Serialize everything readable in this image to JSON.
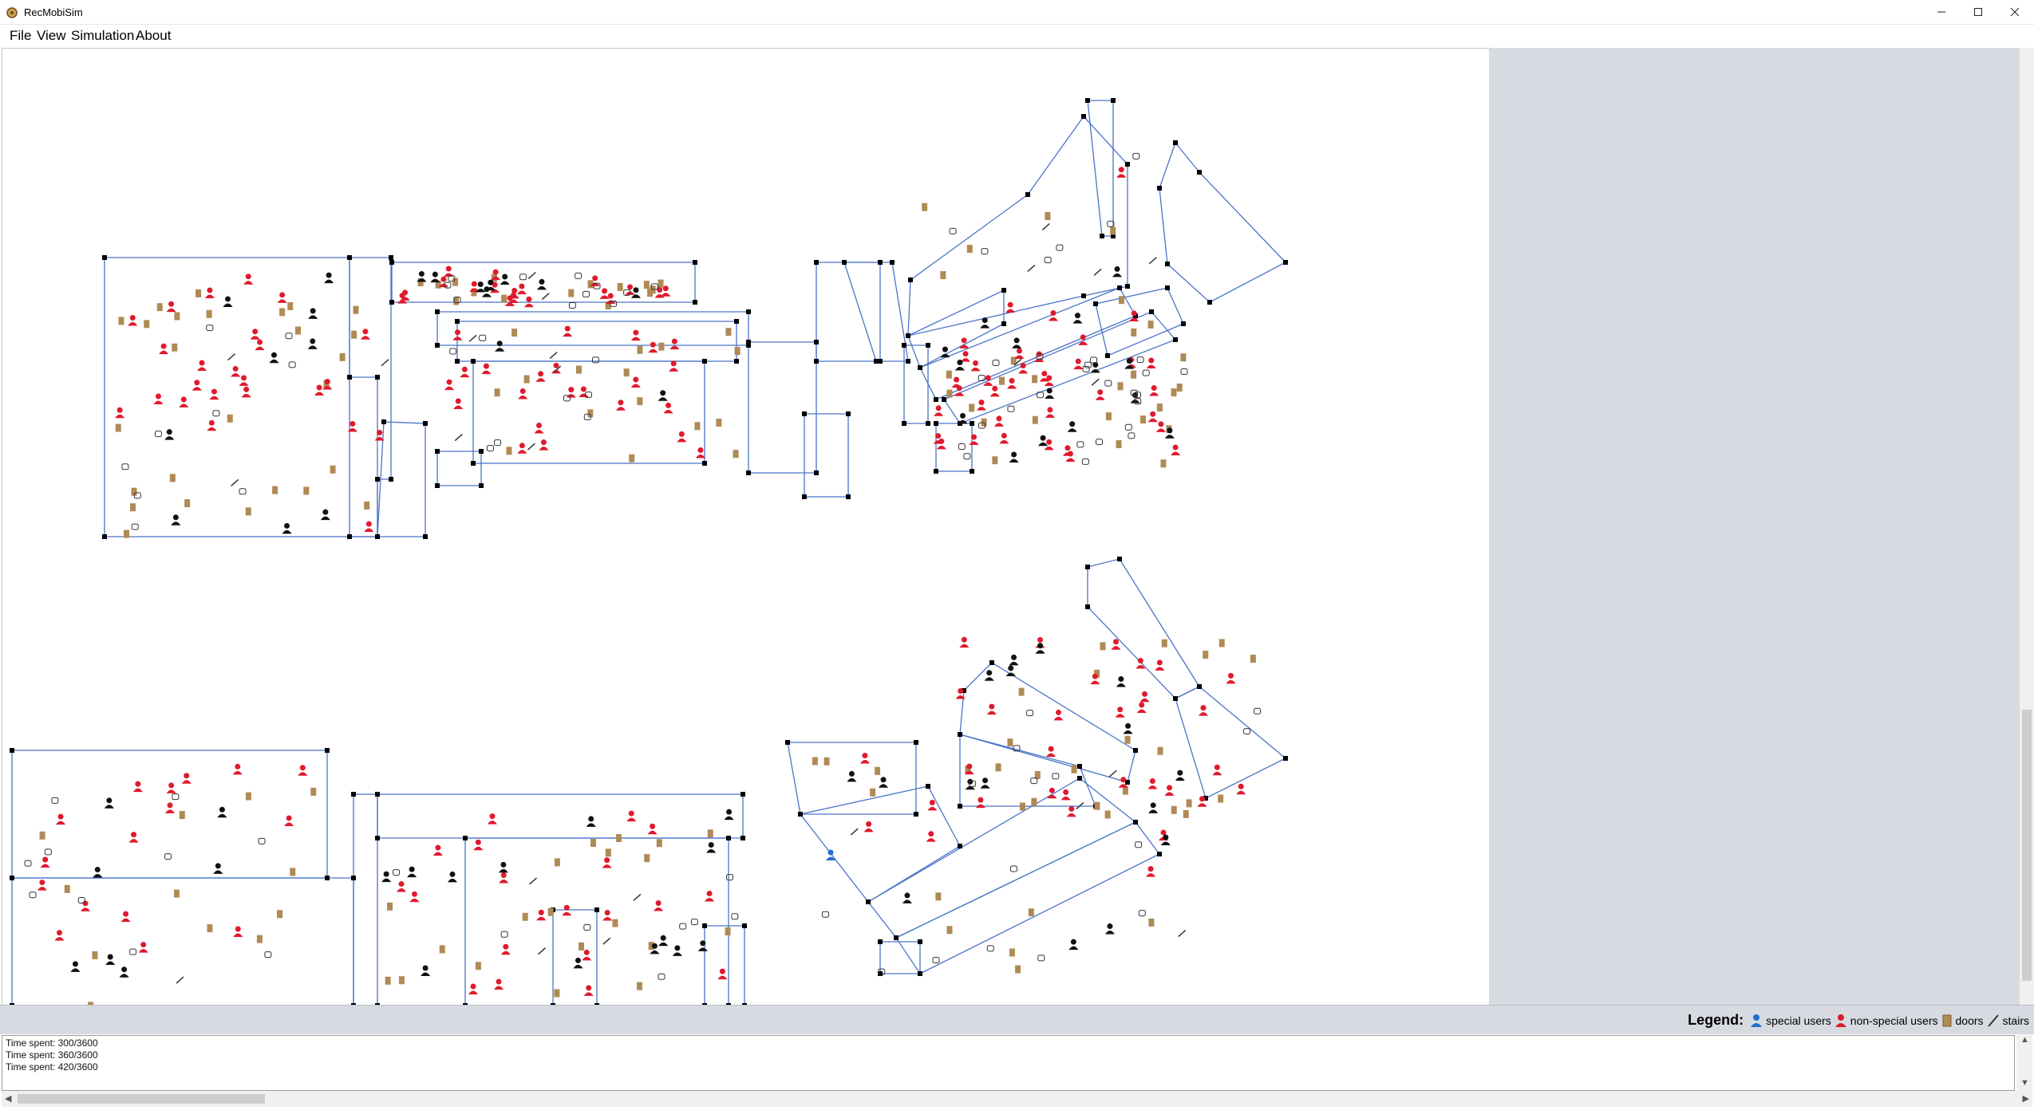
{
  "window": {
    "title": "RecMobiSim"
  },
  "menu": [
    "File",
    "View",
    "Simulation",
    "About"
  ],
  "legend": {
    "title": "Legend:",
    "items": [
      {
        "icon": "special-user-icon",
        "label": "special users",
        "color": "#1f6fd1"
      },
      {
        "icon": "non-special-user-icon",
        "label": "non-special users",
        "color": "#e01a2d"
      },
      {
        "icon": "door-icon",
        "label": "doors",
        "color": "#b08a55"
      },
      {
        "icon": "stairs-icon",
        "label": "stairs",
        "color": "#333333"
      }
    ]
  },
  "log": [
    "Time spent: 300/3600",
    "Time spent: 360/3600",
    "Time spent: 420/3600"
  ],
  "colors": {
    "wall": "#4a74c9",
    "vertex": "#000000",
    "panel": "#d7dae0"
  }
}
